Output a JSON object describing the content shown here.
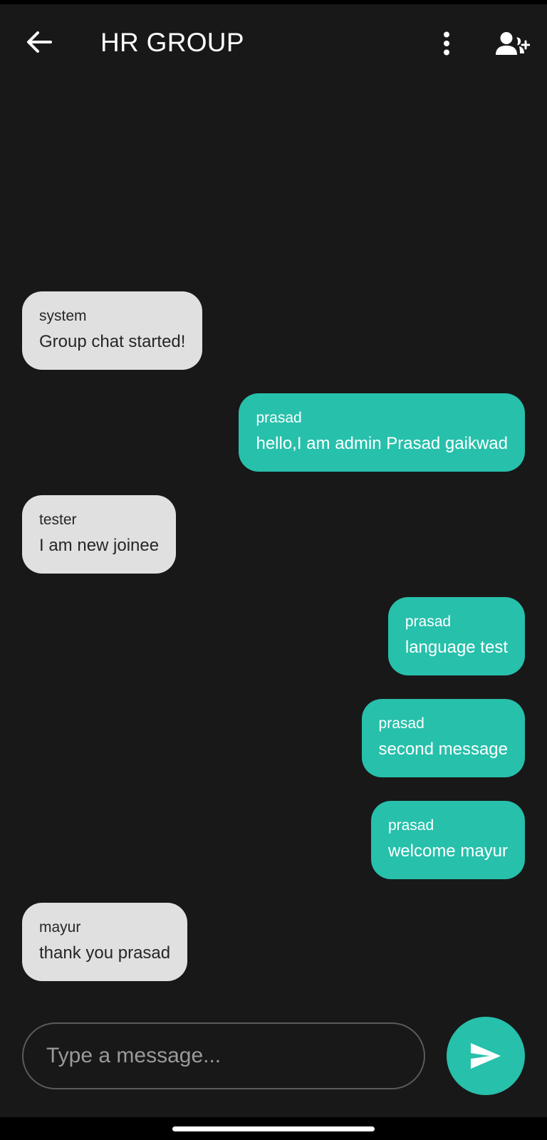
{
  "header": {
    "title": "HR GROUP"
  },
  "messages": [
    {
      "sender": "system",
      "text": "Group chat started!",
      "direction": "incoming"
    },
    {
      "sender": "prasad",
      "text": "hello,I am admin Prasad gaikwad",
      "direction": "outgoing"
    },
    {
      "sender": "tester",
      "text": "I am new joinee",
      "direction": "incoming"
    },
    {
      "sender": "prasad",
      "text": "language test",
      "direction": "outgoing"
    },
    {
      "sender": "prasad",
      "text": "second message",
      "direction": "outgoing"
    },
    {
      "sender": "prasad",
      "text": "welcome mayur",
      "direction": "outgoing"
    },
    {
      "sender": "mayur",
      "text": "thank you prasad",
      "direction": "incoming"
    }
  ],
  "composer": {
    "placeholder": "Type a message...",
    "value": ""
  },
  "colors": {
    "background": "#181818",
    "outgoing_bubble": "#27c0ab",
    "incoming_bubble": "#e0e0e0",
    "outgoing_text": "#ffffff",
    "incoming_text": "#262626",
    "send_button": "#27c0ab"
  },
  "icons": {
    "back": "arrow-left-icon",
    "menu": "more-vertical-icon",
    "add_user": "person-add-icon",
    "send": "send-icon"
  }
}
